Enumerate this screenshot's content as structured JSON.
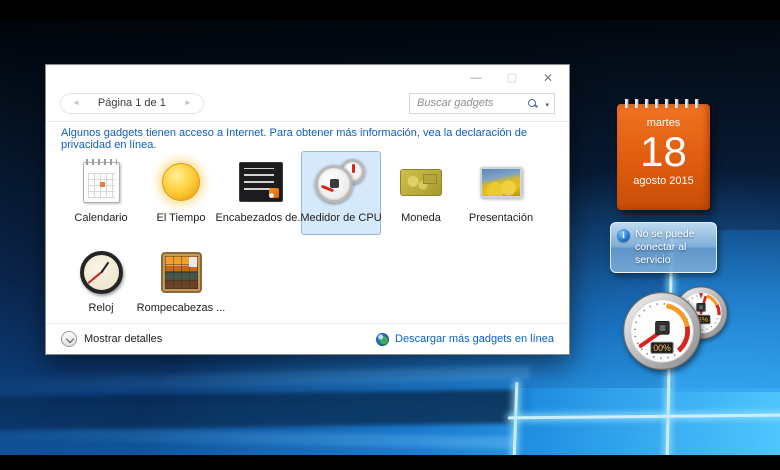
{
  "window": {
    "controls": {
      "minimize": "—",
      "maximize": "▢",
      "close": "✕"
    },
    "pagination": {
      "prev": "◄",
      "label": "Página 1 de 1",
      "next": "►"
    },
    "search": {
      "placeholder": "Buscar gadgets",
      "caret": "▾"
    },
    "notice": "Algunos gadgets tienen acceso a Internet. Para obtener más información, vea la declaración de privacidad en línea.",
    "gallery": {
      "items": [
        {
          "label": "Calendario"
        },
        {
          "label": "El Tiempo"
        },
        {
          "label": "Encabezados de..."
        },
        {
          "label": "Medidor de CPU"
        },
        {
          "label": "Moneda"
        },
        {
          "label": "Presentación"
        },
        {
          "label": "Reloj"
        },
        {
          "label": "Rompecabezas ..."
        }
      ],
      "selected": "Medidor de CPU"
    },
    "footer": {
      "details": "Mostrar detalles",
      "download": "Descargar más gadgets en línea"
    }
  },
  "desktop": {
    "calendar_gadget": {
      "weekday": "martes",
      "day": "18",
      "month_year": "agosto 2015"
    },
    "notification_gadget": {
      "text": "No se puede conectar al servicio",
      "info_glyph": "i"
    },
    "cpu_gadget": {
      "cpu_value": "00%",
      "ram_value": "53%"
    }
  },
  "colors": {
    "selection_bg": "#d6e9fa",
    "selection_border": "#8db8e0",
    "notice_text": "#0c5ec6",
    "link": "#0a62c9",
    "calendar_orange": "#e05c0f",
    "gauge_red": "#d8241c",
    "gauge_orange": "#f59b22"
  }
}
